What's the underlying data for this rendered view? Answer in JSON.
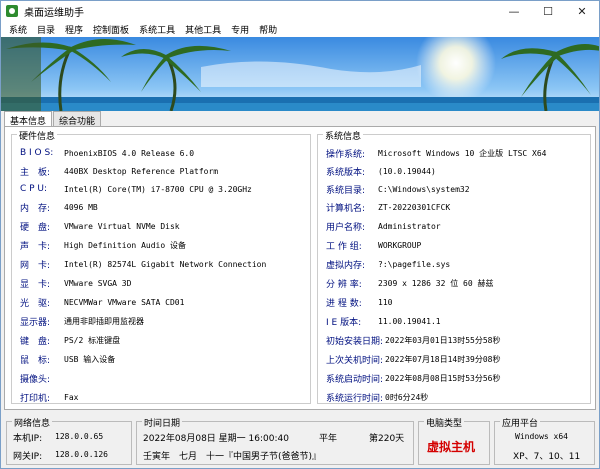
{
  "window": {
    "title": "桌面运维助手",
    "minimize": "—",
    "maximize": "☐",
    "close": "✕"
  },
  "menu": [
    "系统",
    "目录",
    "程序",
    "控制面板",
    "系统工具",
    "其他工具",
    "专用",
    "帮助"
  ],
  "tabs": [
    "基本信息",
    "综合功能"
  ],
  "hardware": {
    "title": "硬件信息",
    "rows": [
      {
        "label": "B I O S:",
        "value": "PhoenixBIOS 4.0 Release 6.0"
      },
      {
        "label": "主　板:",
        "value": "440BX Desktop Reference Platform"
      },
      {
        "label": "C P U:",
        "value": "Intel(R) Core(TM) i7-8700 CPU @ 3.20GHz"
      },
      {
        "label": "内　存:",
        "value": "4096 MB"
      },
      {
        "label": "硬　盘:",
        "value": "VMware Virtual NVMe Disk"
      },
      {
        "label": "声　卡:",
        "value": "High Definition Audio 设备"
      },
      {
        "label": "网　卡:",
        "value": "Intel(R) 82574L Gigabit Network Connection"
      },
      {
        "label": "显　卡:",
        "value": "VMware SVGA 3D"
      },
      {
        "label": "光　驱:",
        "value": "NECVMWar VMware SATA CD01"
      },
      {
        "label": "显示器:",
        "value": "通用非即插即用监视器"
      },
      {
        "label": "键　盘:",
        "value": "PS/2 标准键盘"
      },
      {
        "label": "鼠　标:",
        "value": "USB 输入设备"
      },
      {
        "label": "摄像头:",
        "value": ""
      },
      {
        "label": "打印机:",
        "value": "Fax"
      }
    ]
  },
  "system": {
    "title": "系统信息",
    "rows": [
      {
        "label": "操作系统:",
        "value": "Microsoft Windows 10 企业版 LTSC X64"
      },
      {
        "label": "系统版本:",
        "value": "(10.0.19044)"
      },
      {
        "label": "系统目录:",
        "value": "C:\\Windows\\system32"
      },
      {
        "label": "计算机名:",
        "value": "ZT-20220301CFCK"
      },
      {
        "label": "用户名称:",
        "value": "Administrator"
      },
      {
        "label": "工 作 组:",
        "value": "WORKGROUP"
      },
      {
        "label": "虚拟内存:",
        "value": "?:\\pagefile.sys"
      },
      {
        "label": "分 辨 率:",
        "value": "2309 x 1286 32 位 60 赫兹"
      },
      {
        "label": "进 程 数:",
        "value": "110"
      },
      {
        "label": "I E 版本:",
        "value": "11.00.19041.1"
      },
      {
        "label": "初始安装日期:",
        "value": "2022年03月01日13时55分58秒"
      },
      {
        "label": "上次关机时间:",
        "value": "2022年07月18日14时39分08秒"
      },
      {
        "label": "系统启动时间:",
        "value": "2022年08月08日15时53分56秒"
      },
      {
        "label": "系统运行时间:",
        "value": "0时6分24秒"
      }
    ]
  },
  "network": {
    "title": "网络信息",
    "local_ip_label": "本机IP:",
    "local_ip": "128.0.0.65",
    "gateway_label": "网关IP:",
    "gateway_ip": "128.0.0.126"
  },
  "datetime": {
    "title": "时间日期",
    "line1": "2022年08月08日 星期一 16:00:40",
    "year_type": "平年",
    "day_num": "第220天",
    "line2": "壬寅年　七月　十一『中国男子节(爸爸节)』"
  },
  "pc_type": {
    "title": "电脑类型",
    "value": "虚拟主机"
  },
  "platform": {
    "title": "应用平台",
    "line1": "Windows x64",
    "line2": "XP、7、10、11"
  }
}
